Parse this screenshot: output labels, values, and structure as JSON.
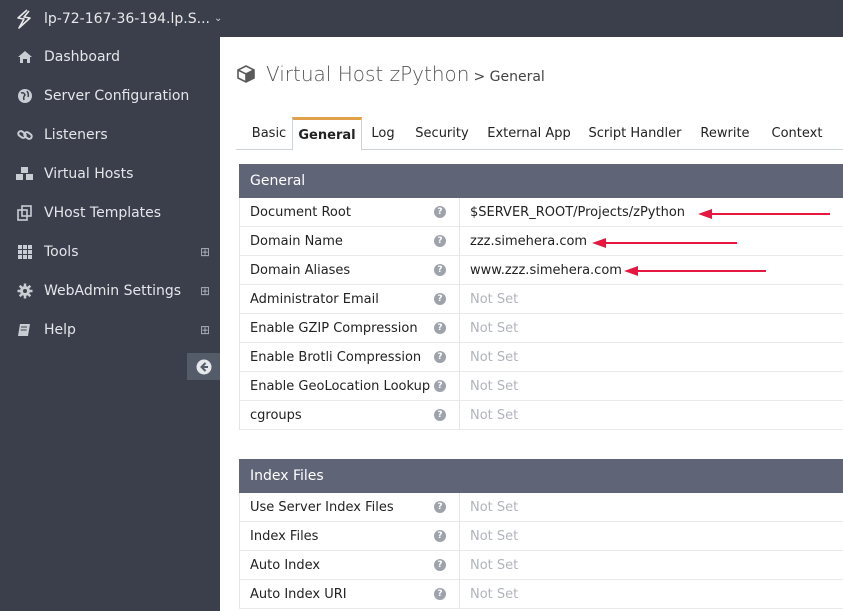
{
  "header": {
    "host": "lp-72-167-36-194.lp.S...",
    "caret": "⌄"
  },
  "sidebar": {
    "items": [
      {
        "label": "Dashboard",
        "icon": "home-icon",
        "expandable": false
      },
      {
        "label": "Server Configuration",
        "icon": "globe-icon",
        "expandable": false
      },
      {
        "label": "Listeners",
        "icon": "link-icon",
        "expandable": false
      },
      {
        "label": "Virtual Hosts",
        "icon": "cubes-icon",
        "expandable": false
      },
      {
        "label": "VHost Templates",
        "icon": "clone-icon",
        "expandable": false
      },
      {
        "label": "Tools",
        "icon": "grid-icon",
        "expandable": true
      },
      {
        "label": "WebAdmin Settings",
        "icon": "gear-icon",
        "expandable": true
      },
      {
        "label": "Help",
        "icon": "book-icon",
        "expandable": true
      }
    ],
    "plus_symbol": "⊞"
  },
  "page": {
    "title": "Virtual Host zPython",
    "subtitle": "> General"
  },
  "tabs": [
    "Basic",
    "General",
    "Log",
    "Security",
    "External App",
    "Script Handler",
    "Rewrite",
    "Context"
  ],
  "active_tab": "General",
  "general": {
    "header": "General",
    "rows": [
      {
        "label": "Document Root",
        "value": "$SERVER_ROOT/Projects/zPython",
        "set": true
      },
      {
        "label": "Domain Name",
        "value": "zzz.simehera.com",
        "set": true
      },
      {
        "label": "Domain Aliases",
        "value": "www.zzz.simehera.com",
        "set": true
      },
      {
        "label": "Administrator Email",
        "value": "Not Set",
        "set": false
      },
      {
        "label": "Enable GZIP Compression",
        "value": "Not Set",
        "set": false
      },
      {
        "label": "Enable Brotli Compression",
        "value": "Not Set",
        "set": false
      },
      {
        "label": "Enable GeoLocation Lookup",
        "value": "Not Set",
        "set": false
      },
      {
        "label": "cgroups",
        "value": "Not Set",
        "set": false
      }
    ]
  },
  "index_files": {
    "header": "Index Files",
    "rows": [
      {
        "label": "Use Server Index Files",
        "value": "Not Set",
        "set": false
      },
      {
        "label": "Index Files",
        "value": "Not Set",
        "set": false
      },
      {
        "label": "Auto Index",
        "value": "Not Set",
        "set": false
      },
      {
        "label": "Auto Index URI",
        "value": "Not Set",
        "set": false
      }
    ]
  },
  "help_symbol": "?",
  "colors": {
    "sidebar": "#3a3f4b",
    "section_header": "#5f6477",
    "active_tab_accent": "#e1a14a",
    "annotation_arrow": "#e8173f"
  }
}
